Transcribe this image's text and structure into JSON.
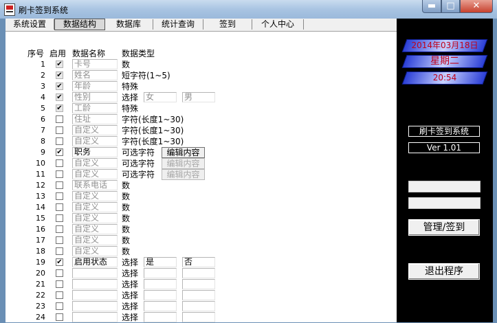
{
  "window": {
    "title": "刷卡签到系统",
    "min_glyph": "▬",
    "max_glyph": "□",
    "close_glyph": "✕"
  },
  "menu": [
    "系统设置",
    "数据结构",
    "数据库",
    "统计查询",
    "签到",
    "个人中心"
  ],
  "table": {
    "headers": {
      "seq": "序号",
      "enabled": "启用",
      "name": "数据名称",
      "type": "数据类型"
    },
    "rows": [
      {
        "num": "1",
        "checked": true,
        "locked": true,
        "name": "卡号",
        "dim": true,
        "type": "数"
      },
      {
        "num": "2",
        "checked": true,
        "locked": true,
        "name": "姓名",
        "dim": true,
        "type": "短字符(1~5)"
      },
      {
        "num": "3",
        "checked": true,
        "locked": true,
        "name": "年龄",
        "dim": true,
        "type": "特殊"
      },
      {
        "num": "4",
        "checked": true,
        "locked": true,
        "name": "性别",
        "dim": true,
        "type": "选择",
        "opt1": "女",
        "opt2": "男",
        "optdim": true
      },
      {
        "num": "5",
        "checked": true,
        "locked": true,
        "name": "工龄",
        "dim": true,
        "type": "特殊"
      },
      {
        "num": "6",
        "checked": false,
        "name": "住址",
        "dim": true,
        "type": "字符(长度1~30)"
      },
      {
        "num": "7",
        "checked": false,
        "name": "自定义",
        "dim": true,
        "type": "字符(长度1~30)"
      },
      {
        "num": "8",
        "checked": false,
        "name": "自定义",
        "dim": true,
        "type": "字符(长度1~30)"
      },
      {
        "num": "9",
        "checked": true,
        "name": "职务",
        "dim": false,
        "type": "可选字符",
        "btn": "编辑内容",
        "btnEnabled": true
      },
      {
        "num": "10",
        "checked": false,
        "name": "自定义",
        "dim": true,
        "type": "可选字符",
        "btn": "编辑内容",
        "btnEnabled": false
      },
      {
        "num": "11",
        "checked": false,
        "name": "自定义",
        "dim": true,
        "type": "可选字符",
        "btn": "编辑内容",
        "btnEnabled": false
      },
      {
        "num": "12",
        "checked": false,
        "name": "联系电话",
        "dim": true,
        "type": "数"
      },
      {
        "num": "13",
        "checked": false,
        "name": "自定义",
        "dim": true,
        "type": "数"
      },
      {
        "num": "14",
        "checked": false,
        "name": "自定义",
        "dim": true,
        "type": "数"
      },
      {
        "num": "15",
        "checked": false,
        "name": "自定义",
        "dim": true,
        "type": "数"
      },
      {
        "num": "16",
        "checked": false,
        "name": "自定义",
        "dim": true,
        "type": "数"
      },
      {
        "num": "17",
        "checked": false,
        "name": "自定义",
        "dim": true,
        "type": "数"
      },
      {
        "num": "18",
        "checked": false,
        "name": "自定义",
        "dim": true,
        "type": "数"
      },
      {
        "num": "19",
        "checked": true,
        "name": "启用状态",
        "dim": false,
        "type": "选择",
        "opt1": "是",
        "opt2": "否",
        "optdim": false
      },
      {
        "num": "20",
        "checked": false,
        "name": "",
        "dim": false,
        "type": "选择",
        "opt1": "",
        "opt2": "",
        "optdim": false
      },
      {
        "num": "21",
        "checked": false,
        "name": "",
        "dim": false,
        "type": "选择",
        "opt1": "",
        "opt2": "",
        "optdim": false
      },
      {
        "num": "22",
        "checked": false,
        "name": "",
        "dim": false,
        "type": "选择",
        "opt1": "",
        "opt2": "",
        "optdim": false
      },
      {
        "num": "23",
        "checked": false,
        "name": "",
        "dim": false,
        "type": "选择",
        "opt1": "",
        "opt2": "",
        "optdim": false
      },
      {
        "num": "24",
        "checked": false,
        "name": "",
        "dim": false,
        "type": "选择",
        "opt1": "",
        "opt2": "",
        "optdim": false
      }
    ]
  },
  "side_panel": {
    "date": "2014年03月18日",
    "weekday": "星期二",
    "time": "20:54",
    "system_label": "刷卡签到系统",
    "version": "Ver 1.01",
    "manage_button": "管理/签到",
    "exit_button": "退出程序",
    "input1": "",
    "input2": ""
  },
  "colors": {
    "title_bg": "#a9c4e2",
    "panel_bg": "#000000",
    "banner": "#2b3fd6",
    "banner_text": "#c0001a"
  }
}
